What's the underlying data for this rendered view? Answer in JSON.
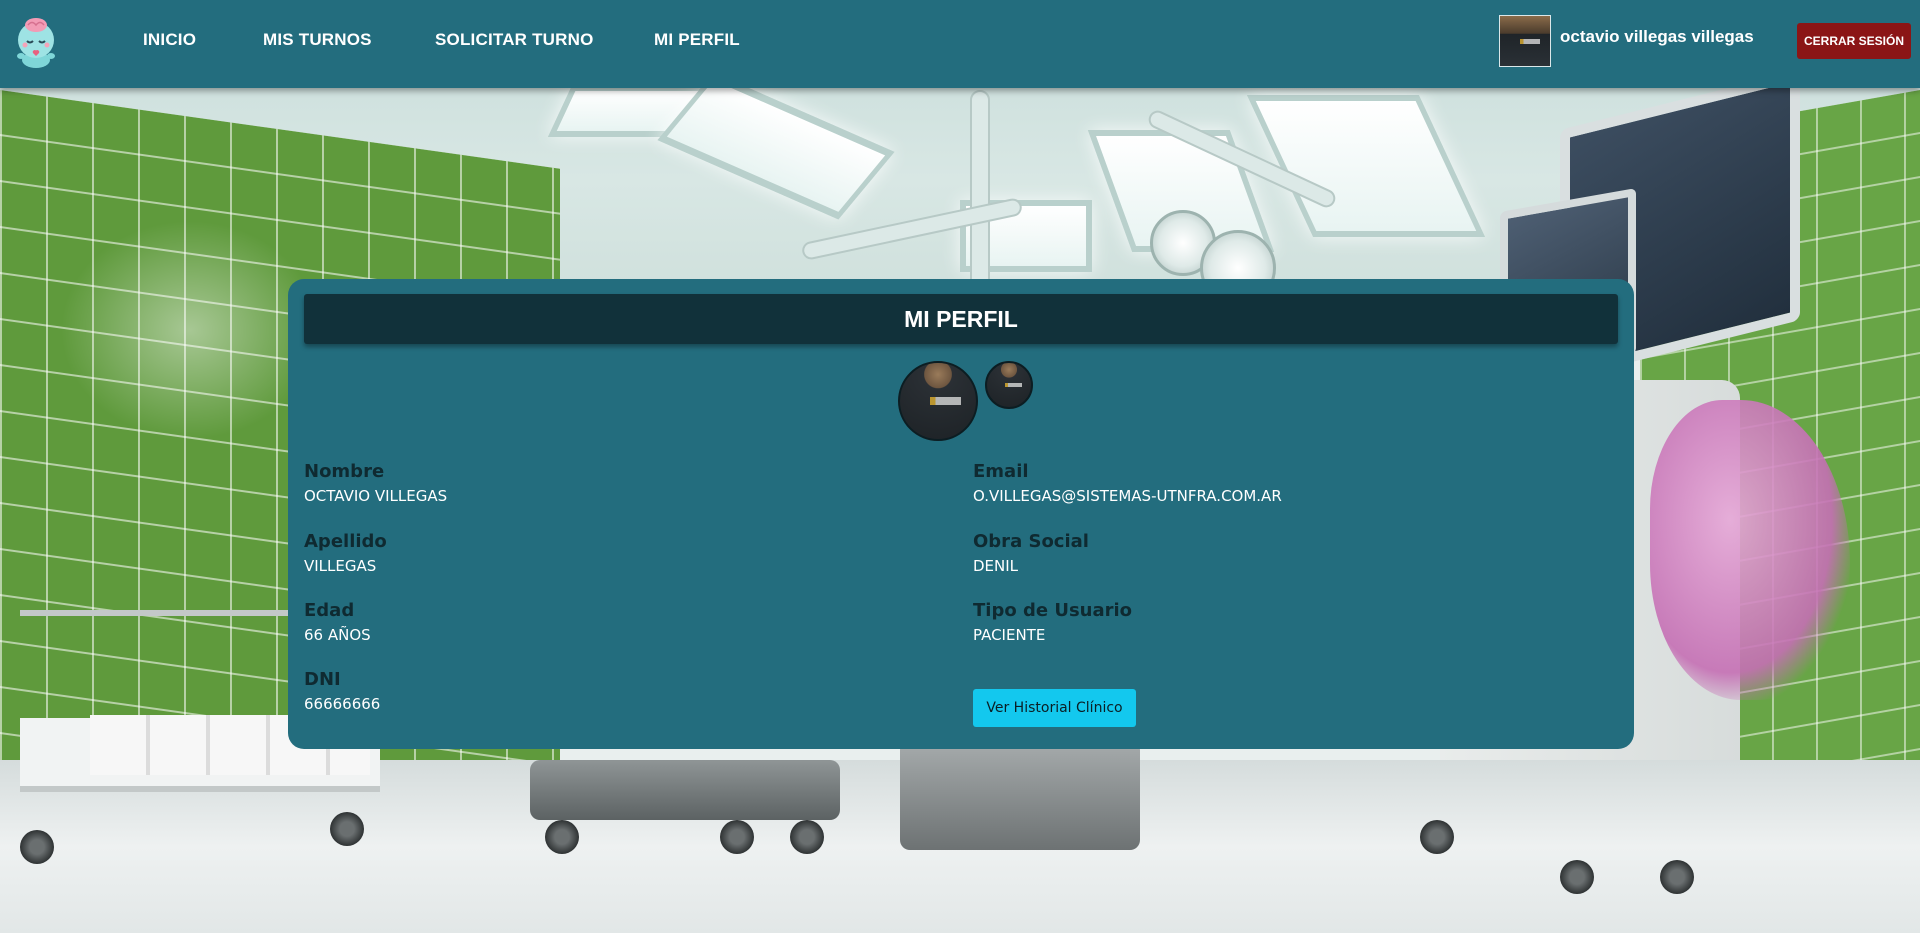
{
  "navbar": {
    "links": {
      "inicio": "INICIO",
      "mis_turnos": "MIS TURNOS",
      "solicitar_turno": "SOLICITAR TURNO",
      "mi_perfil": "MI PERFIL"
    },
    "user_name": "octavio villegas villegas",
    "logout_label": "CERRAR SESIÓN",
    "logo_icon": "brain-character-icon"
  },
  "profile": {
    "title": "MI PERFIL",
    "fields": {
      "nombre": {
        "label": "Nombre",
        "value": "OCTAVIO VILLEGAS"
      },
      "apellido": {
        "label": "Apellido",
        "value": "VILLEGAS"
      },
      "edad": {
        "label": "Edad",
        "value": "66 AÑOS"
      },
      "dni": {
        "label": "DNI",
        "value": "66666666"
      },
      "email": {
        "label": "Email",
        "value": "O.VILLEGAS@SISTEMAS-UTNFRA.COM.AR"
      },
      "obra_social": {
        "label": "Obra Social",
        "value": "DENIL"
      },
      "tipo_usuario": {
        "label": "Tipo de Usuario",
        "value": "PACIENTE"
      }
    },
    "historial_button": "Ver Historial Clínico"
  },
  "colors": {
    "navbar_bg": "#236d7e",
    "card_bg": "#236d7e",
    "card_header_bg": "#11313a",
    "logout_bg": "#8b1516",
    "historial_btn_bg": "#13c8ee"
  }
}
